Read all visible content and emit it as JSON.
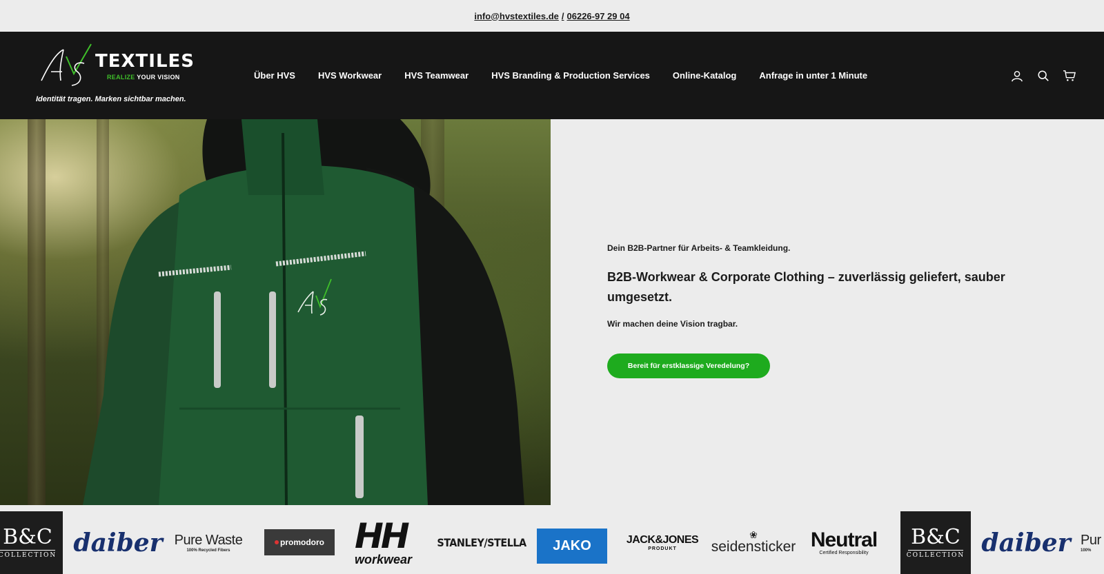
{
  "topbar": {
    "email": "info@hvstextiles.de",
    "separator": "/",
    "phone": "06226-97 29 04"
  },
  "header": {
    "logo": {
      "mark": "HVS",
      "wordmark": "TEXTILES",
      "tagline_accent": "REALIZE",
      "tagline_rest": "YOUR VISION"
    },
    "claim": "Identität tragen. Marken sichtbar machen.",
    "nav": [
      {
        "label": "Über HVS"
      },
      {
        "label": "HVS Workwear"
      },
      {
        "label": "HVS Teamwear"
      },
      {
        "label": "HVS Branding & Production Services"
      },
      {
        "label": "Online-Katalog"
      },
      {
        "label": "Anfrage in unter 1 Minute"
      }
    ],
    "icons": [
      "user-icon",
      "search-icon",
      "cart-icon"
    ]
  },
  "hero": {
    "kicker": "Dein B2B-Partner für Arbeits- & Teamkleidung.",
    "title": "B2B-Workwear & Corporate Clothing – zuverlässig geliefert, sauber umgesetzt.",
    "subtitle": "Wir machen deine Vision tragbar.",
    "cta": "Bereit für erstklassige Veredelung?"
  },
  "brands": {
    "bc": {
      "mark": "B&C",
      "sub": "COLLECTION"
    },
    "daiber": "daiber",
    "purewaste": {
      "name": "Pure Waste",
      "sub": "100% Recycled Fibers"
    },
    "promodoro": "promodoro",
    "hh": {
      "mark": "HH",
      "sub": "workwear"
    },
    "stanley": "STANLEY/STELLA",
    "jako": "JAKO",
    "jackjones": {
      "name": "JACK&JONES",
      "sub": "PRODUKT"
    },
    "seidensticker": "seidensticker",
    "neutral": {
      "name": "Neutral",
      "sub": "Certified Responsibility"
    },
    "purewaste_partial": {
      "name": "Pur",
      "sub": "100%"
    }
  },
  "colors": {
    "accent": "#1eab1e",
    "header_bg": "#161616",
    "page_bg": "#ececec"
  }
}
